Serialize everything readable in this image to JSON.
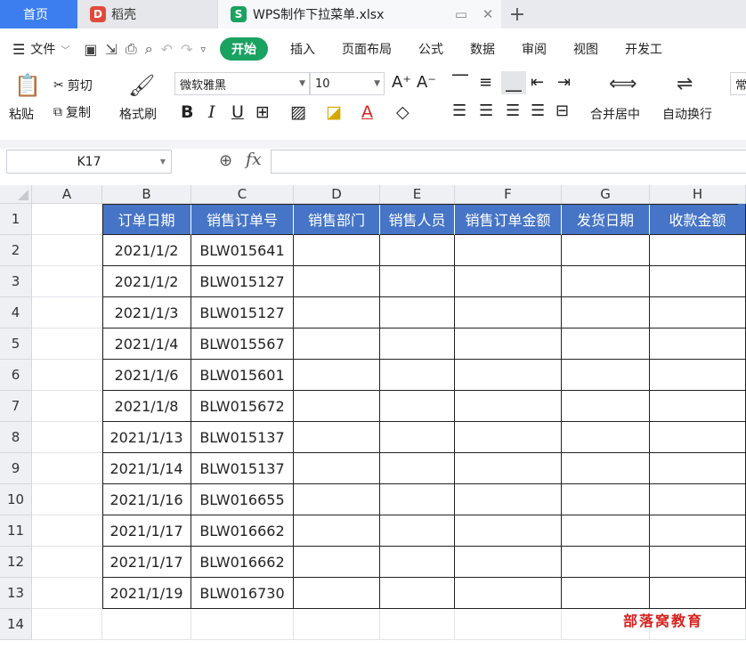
{
  "tabs": {
    "home": "首页",
    "docer": "稻壳",
    "docer_logo": "D",
    "file": "WPS制作下拉菜单.xlsx",
    "file_logo": "S"
  },
  "menu": {
    "file": "文件",
    "start": "开始",
    "items": [
      "插入",
      "页面布局",
      "公式",
      "数据",
      "审阅",
      "视图",
      "开发工"
    ]
  },
  "ribbon": {
    "paste": "粘贴",
    "cut": "剪切",
    "copy": "复制",
    "format_painter": "格式刷",
    "font_name": "微软雅黑",
    "font_size": "10",
    "merge_center": "合并居中",
    "auto_wrap": "自动换行",
    "number_format": "常"
  },
  "formula_bar": {
    "cell_ref": "K17",
    "fx": "fx",
    "value": ""
  },
  "sheet": {
    "columns": [
      "A",
      "B",
      "C",
      "D",
      "E",
      "F",
      "G",
      "H"
    ],
    "rows": [
      "1",
      "2",
      "3",
      "4",
      "5",
      "6",
      "7",
      "8",
      "9",
      "10",
      "11",
      "12",
      "13",
      "14"
    ],
    "headers": [
      "订单日期",
      "销售订单号",
      "销售部门",
      "销售人员",
      "销售订单金额",
      "发货日期",
      "收款金额"
    ],
    "data": [
      [
        "2021/1/2",
        "BLW015641"
      ],
      [
        "2021/1/2",
        "BLW015127"
      ],
      [
        "2021/1/3",
        "BLW015127"
      ],
      [
        "2021/1/4",
        "BLW015567"
      ],
      [
        "2021/1/6",
        "BLW015601"
      ],
      [
        "2021/1/8",
        "BLW015672"
      ],
      [
        "2021/1/13",
        "BLW015137"
      ],
      [
        "2021/1/14",
        "BLW015137"
      ],
      [
        "2021/1/16",
        "BLW016655"
      ],
      [
        "2021/1/17",
        "BLW016662"
      ],
      [
        "2021/1/17",
        "BLW016662"
      ],
      [
        "2021/1/19",
        "BLW016730"
      ]
    ]
  },
  "watermark": "部落窝教育",
  "colors": {
    "header_fill": "#4674c6",
    "home_tab": "#3c7ef0",
    "start_btn": "#1aa260",
    "watermark": "#d6221e"
  }
}
